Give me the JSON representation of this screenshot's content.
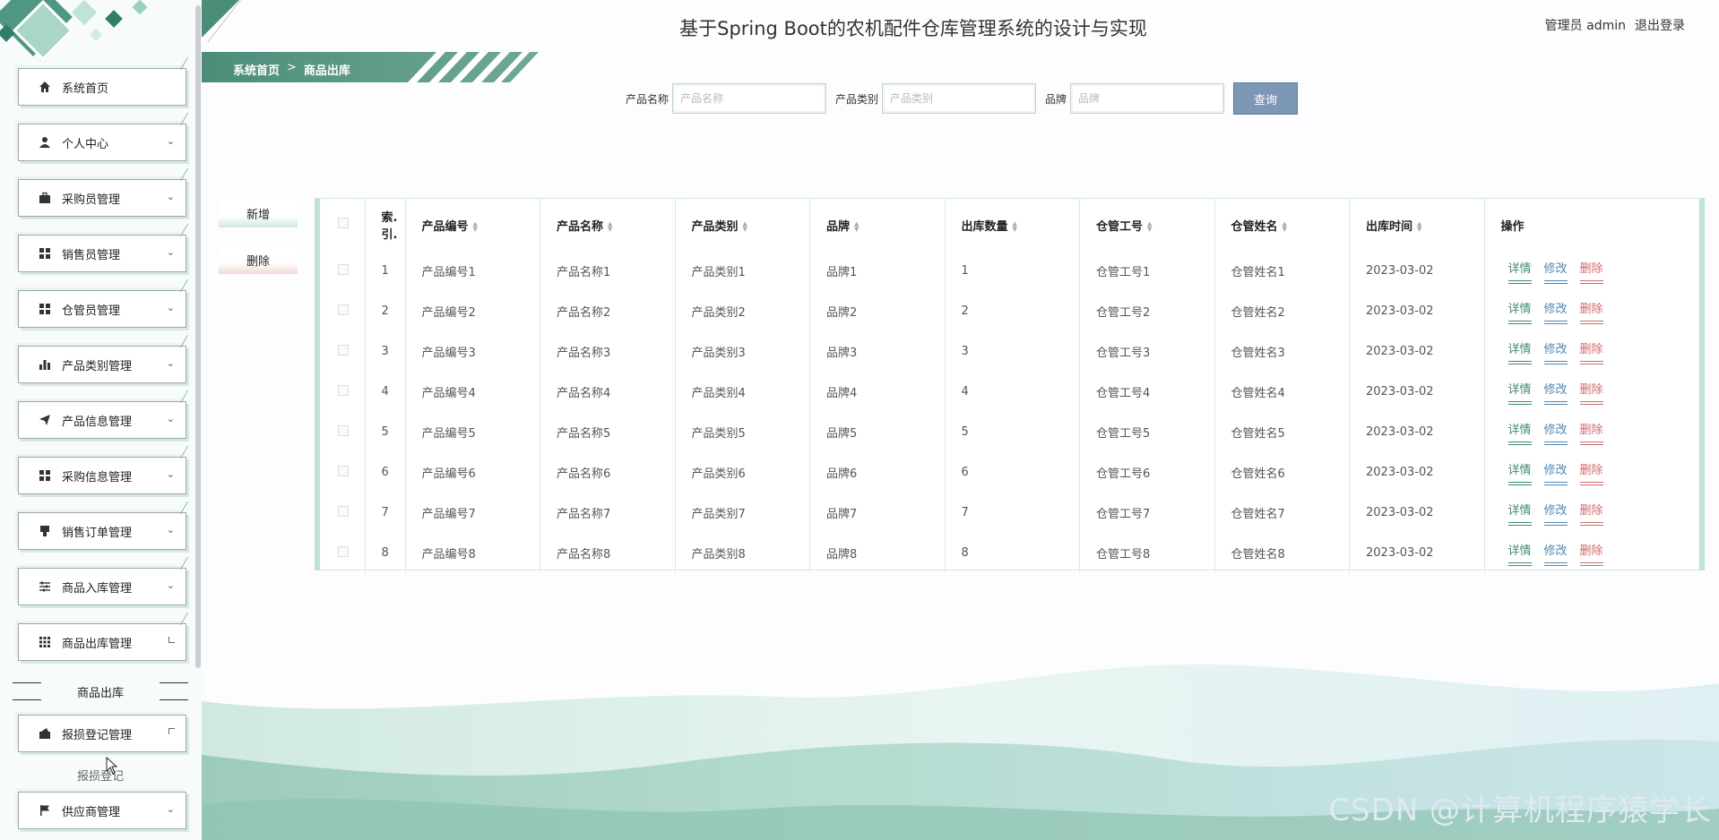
{
  "header": {
    "title": "基于Spring Boot的农机配件仓库管理系统的设计与实现",
    "user_label": "管理员 admin",
    "logout_label": "退出登录"
  },
  "breadcrumb": {
    "home": "系统首页",
    "separator": ">",
    "current": "商品出库"
  },
  "sidebar": {
    "items": [
      {
        "label": "系统首页",
        "icon": "home-icon"
      },
      {
        "label": "个人中心",
        "icon": "user-icon"
      },
      {
        "label": "采购员管理",
        "icon": "briefcase-icon"
      },
      {
        "label": "销售员管理",
        "icon": "grid-icon"
      },
      {
        "label": "仓管员管理",
        "icon": "grid-icon"
      },
      {
        "label": "产品类别管理",
        "icon": "bar-chart-icon"
      },
      {
        "label": "产品信息管理",
        "icon": "send-icon"
      },
      {
        "label": "采购信息管理",
        "icon": "grid-icon"
      },
      {
        "label": "销售订单管理",
        "icon": "stamp-icon"
      },
      {
        "label": "商品入库管理",
        "icon": "sliders-icon"
      },
      {
        "label": "商品出库管理",
        "icon": "apps-icon"
      },
      {
        "label": "报损登记管理",
        "icon": "wallet-icon"
      },
      {
        "label": "供应商管理",
        "icon": "flag-icon"
      }
    ],
    "sub_items": [
      {
        "label": "商品出库"
      },
      {
        "label": "报损登记"
      }
    ]
  },
  "search": {
    "product_name_label": "产品名称",
    "product_name_placeholder": "产品名称",
    "product_category_label": "产品类别",
    "product_category_placeholder": "产品类别",
    "brand_label": "品牌",
    "brand_placeholder": "品牌",
    "query_label": "查询"
  },
  "actions": {
    "add_label": "新增",
    "delete_label": "删除"
  },
  "table": {
    "columns": [
      "索引",
      "产品编号",
      "产品名称",
      "产品类别",
      "品牌",
      "出库数量",
      "仓管工号",
      "仓管姓名",
      "出库时间",
      "操作"
    ],
    "index_header_lines": [
      "索.",
      "引."
    ],
    "operations": {
      "detail": "详情",
      "edit": "修改",
      "delete": "删除"
    },
    "rows": [
      [
        "1",
        "产品编号1",
        "产品名称1",
        "产品类别1",
        "品牌1",
        "1",
        "仓管工号1",
        "仓管姓名1",
        "2023-03-02"
      ],
      [
        "2",
        "产品编号2",
        "产品名称2",
        "产品类别2",
        "品牌2",
        "2",
        "仓管工号2",
        "仓管姓名2",
        "2023-03-02"
      ],
      [
        "3",
        "产品编号3",
        "产品名称3",
        "产品类别3",
        "品牌3",
        "3",
        "仓管工号3",
        "仓管姓名3",
        "2023-03-02"
      ],
      [
        "4",
        "产品编号4",
        "产品名称4",
        "产品类别4",
        "品牌4",
        "4",
        "仓管工号4",
        "仓管姓名4",
        "2023-03-02"
      ],
      [
        "5",
        "产品编号5",
        "产品名称5",
        "产品类别5",
        "品牌5",
        "5",
        "仓管工号5",
        "仓管姓名5",
        "2023-03-02"
      ],
      [
        "6",
        "产品编号6",
        "产品名称6",
        "产品类别6",
        "品牌6",
        "6",
        "仓管工号6",
        "仓管姓名6",
        "2023-03-02"
      ],
      [
        "7",
        "产品编号7",
        "产品名称7",
        "产品类别7",
        "品牌7",
        "7",
        "仓管工号7",
        "仓管姓名7",
        "2023-03-02"
      ],
      [
        "8",
        "产品编号8",
        "产品名称8",
        "产品类别8",
        "品牌8",
        "8",
        "仓管工号8",
        "仓管姓名8",
        "2023-03-02"
      ]
    ]
  },
  "watermark": "CSDN @计算机程序猿学长",
  "colors": {
    "accent": "#4c8d7a",
    "query_button": "#7d97b6",
    "detail_link": "#3f8a73",
    "edit_link": "#4d87b7",
    "delete_link": "#d06a6a"
  }
}
